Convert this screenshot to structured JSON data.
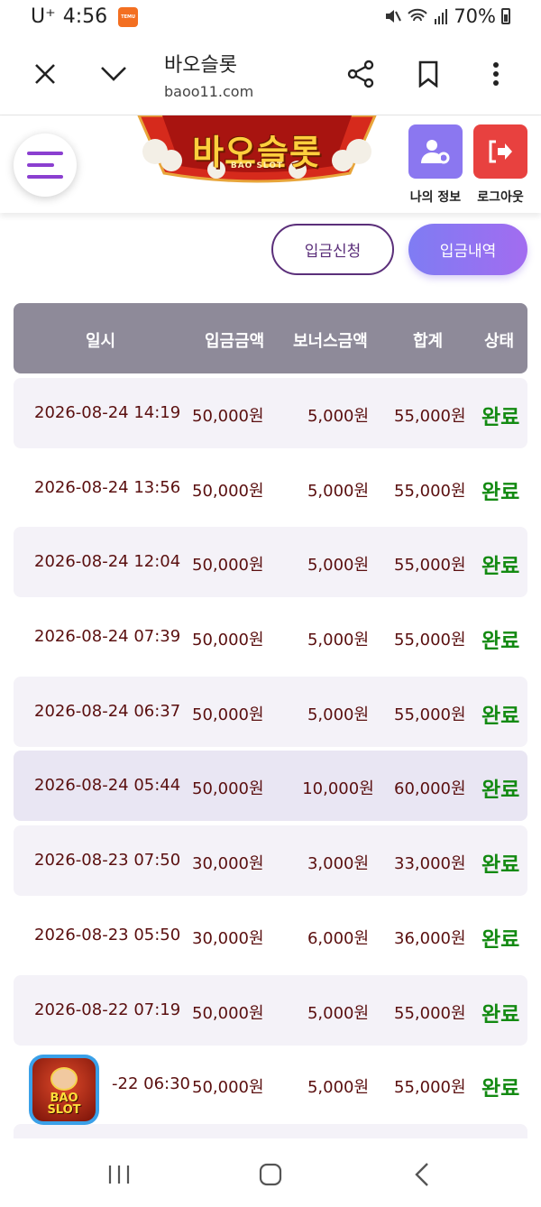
{
  "status_bar": {
    "carrier": "U⁺",
    "time": "4:56",
    "temu_badge": "TEMU",
    "battery": "70%"
  },
  "browser": {
    "title": "바오슬롯",
    "url": "baoo11.com",
    "icons": [
      "close-icon",
      "chevron-down-icon",
      "share-icon",
      "bookmark-icon",
      "more-vert-icon"
    ]
  },
  "header": {
    "logo_text": "바오슬롯",
    "logo_sub": "BAO SLOT",
    "my_info_label": "나의 정보",
    "logout_label": "로그아웃",
    "my_info_color": "#8b77f0",
    "logout_color": "#e8413f"
  },
  "buttons": {
    "deposit_request": "입금신청",
    "deposit_history": "입금내역"
  },
  "table": {
    "headers": [
      "일시",
      "입금금액",
      "보너스금액",
      "합계",
      "상태"
    ],
    "rows": [
      [
        "2026-08-24 14:19",
        "50,000원",
        "5,000원",
        "55,000원",
        "완료"
      ],
      [
        "2026-08-24 13:56",
        "50,000원",
        "5,000원",
        "55,000원",
        "완료"
      ],
      [
        "2026-08-24 12:04",
        "50,000원",
        "5,000원",
        "55,000원",
        "완료"
      ],
      [
        "2026-08-24 07:39",
        "50,000원",
        "5,000원",
        "55,000원",
        "완료"
      ],
      [
        "2026-08-24 06:37",
        "50,000원",
        "5,000원",
        "55,000원",
        "완료"
      ],
      [
        "2026-08-24 05:44",
        "50,000원",
        "10,000원",
        "60,000원",
        "완료"
      ],
      [
        "2026-08-23 07:50",
        "30,000원",
        "3,000원",
        "33,000원",
        "완료"
      ],
      [
        "2026-08-23 05:50",
        "30,000원",
        "6,000원",
        "36,000원",
        "완료"
      ],
      [
        "2026-08-22 07:19",
        "50,000원",
        "5,000원",
        "55,000원",
        "완료"
      ],
      [
        "-22 06:30",
        "50,000원",
        "5,000원",
        "55,000원",
        "완료"
      ]
    ]
  },
  "float_logo_text": "BAO SLOT",
  "colors": {
    "status_done": "#138a12",
    "table_header": "#8e8a99",
    "accent": "#5b2f7a"
  }
}
